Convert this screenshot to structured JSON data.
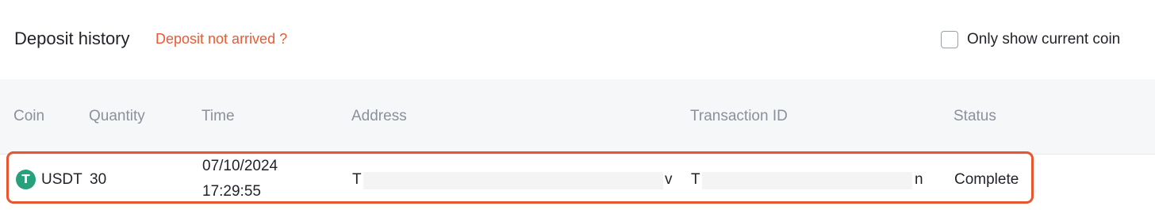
{
  "header": {
    "title": "Deposit history",
    "not_arrived_link": "Deposit not arrived ?",
    "only_current_label": "Only show current coin",
    "only_current_checked": false
  },
  "table": {
    "columns": [
      "Coin",
      "Quantity",
      "Time",
      "Address",
      "Transaction ID",
      "Status"
    ],
    "rows": [
      {
        "coin": "USDT",
        "coin_icon": "tether-icon",
        "coin_icon_glyph": "T",
        "quantity": "30",
        "date": "07/10/2024",
        "time": "17:29:55",
        "address_start": "T",
        "address_end": "v",
        "txid_start": "T",
        "txid_end": "n",
        "status": "Complete"
      }
    ]
  },
  "colors": {
    "accent": "#ec5a33",
    "highlight_border": "#e9552e",
    "usdt_green": "#26a17b",
    "header_bg": "#f6f7f9",
    "column_text": "#8a919c"
  }
}
